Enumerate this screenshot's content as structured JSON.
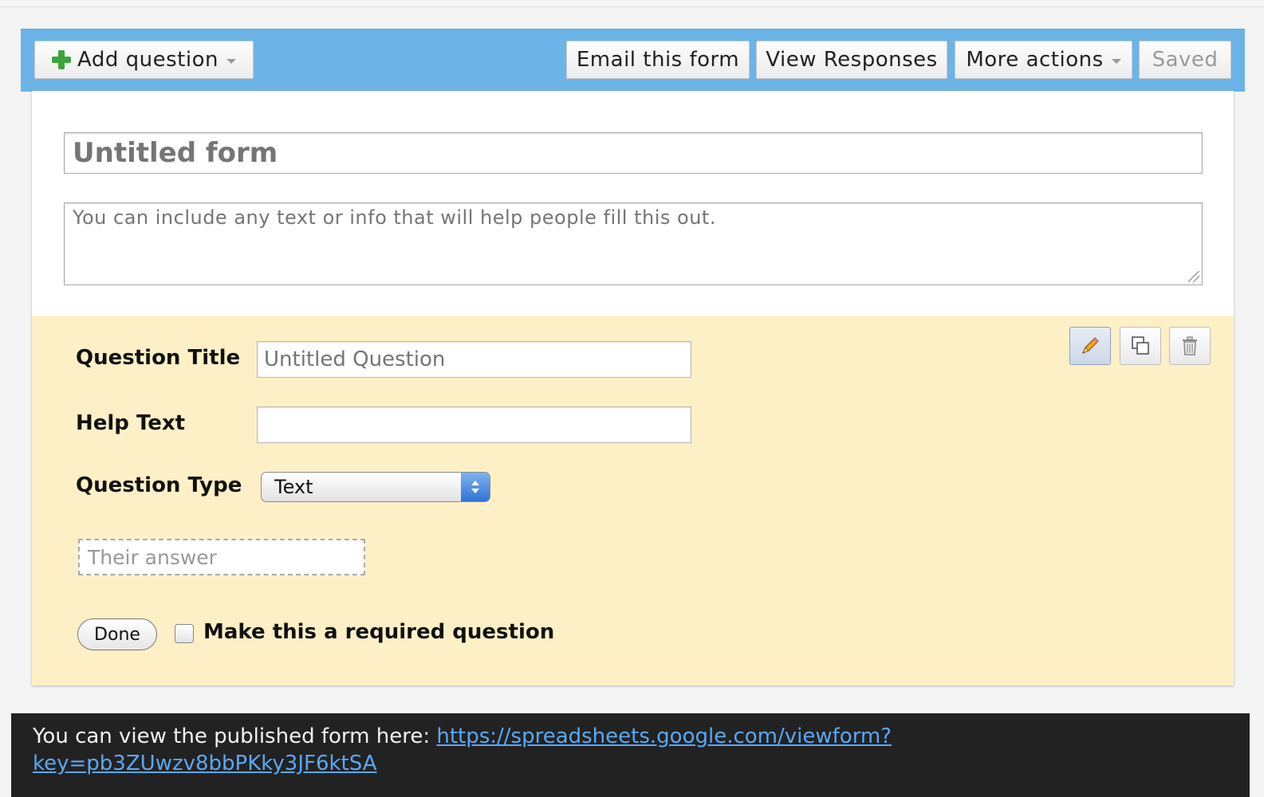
{
  "toolbar": {
    "add_question_label": "Add question",
    "email_label": "Email this form",
    "view_responses_label": "View Responses",
    "more_actions_label": "More actions",
    "saved_label": "Saved"
  },
  "form": {
    "title_placeholder": "Untitled form",
    "description_placeholder": "You can include any text or info that will help people fill this out."
  },
  "question": {
    "title_label": "Question Title",
    "title_placeholder": "Untitled Question",
    "help_label": "Help Text",
    "help_value": "",
    "type_label": "Question Type",
    "type_selected": "Text",
    "answer_preview": "Their answer",
    "done_label": "Done",
    "required_label": "Make this a required question",
    "required_checked": false,
    "actions": [
      "edit-icon",
      "duplicate-icon",
      "delete-icon"
    ]
  },
  "footer": {
    "prefix": "You can view the published form here: ",
    "link_text": "https://spreadsheets.google.com/viewform?key=pb3ZUwzv8bbPKky3JF6ktSA"
  },
  "colors": {
    "toolbar_bg": "#6cb4e7",
    "question_bg": "#fef0c6",
    "footer_bg": "#222222",
    "link": "#5aa8f5",
    "plus_green": "#3aa53a"
  }
}
